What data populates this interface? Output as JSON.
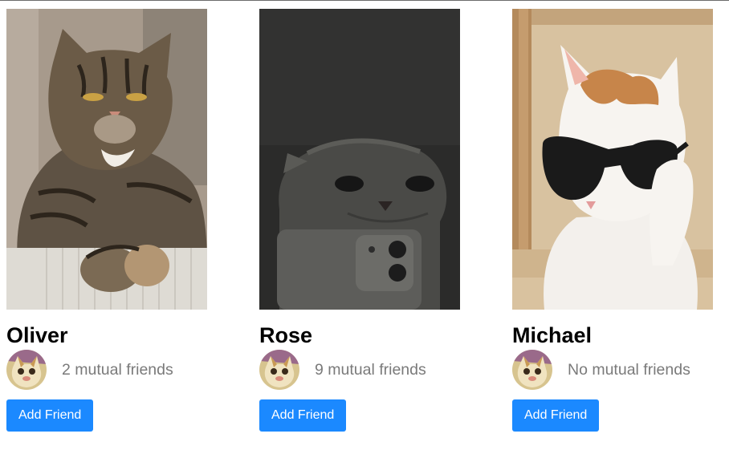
{
  "accent_color": "#1b89ff",
  "cards": [
    {
      "name": "Oliver",
      "mutual": "2 mutual friends",
      "button": "Add Friend",
      "photo_icon": "tabby-cat-photo"
    },
    {
      "name": "Rose",
      "mutual": "9 mutual friends",
      "button": "Add Friend",
      "photo_icon": "grey-cat-selfie-photo"
    },
    {
      "name": "Michael",
      "mutual": "No mutual friends",
      "button": "Add Friend",
      "photo_icon": "cat-sunglasses-photo"
    }
  ]
}
